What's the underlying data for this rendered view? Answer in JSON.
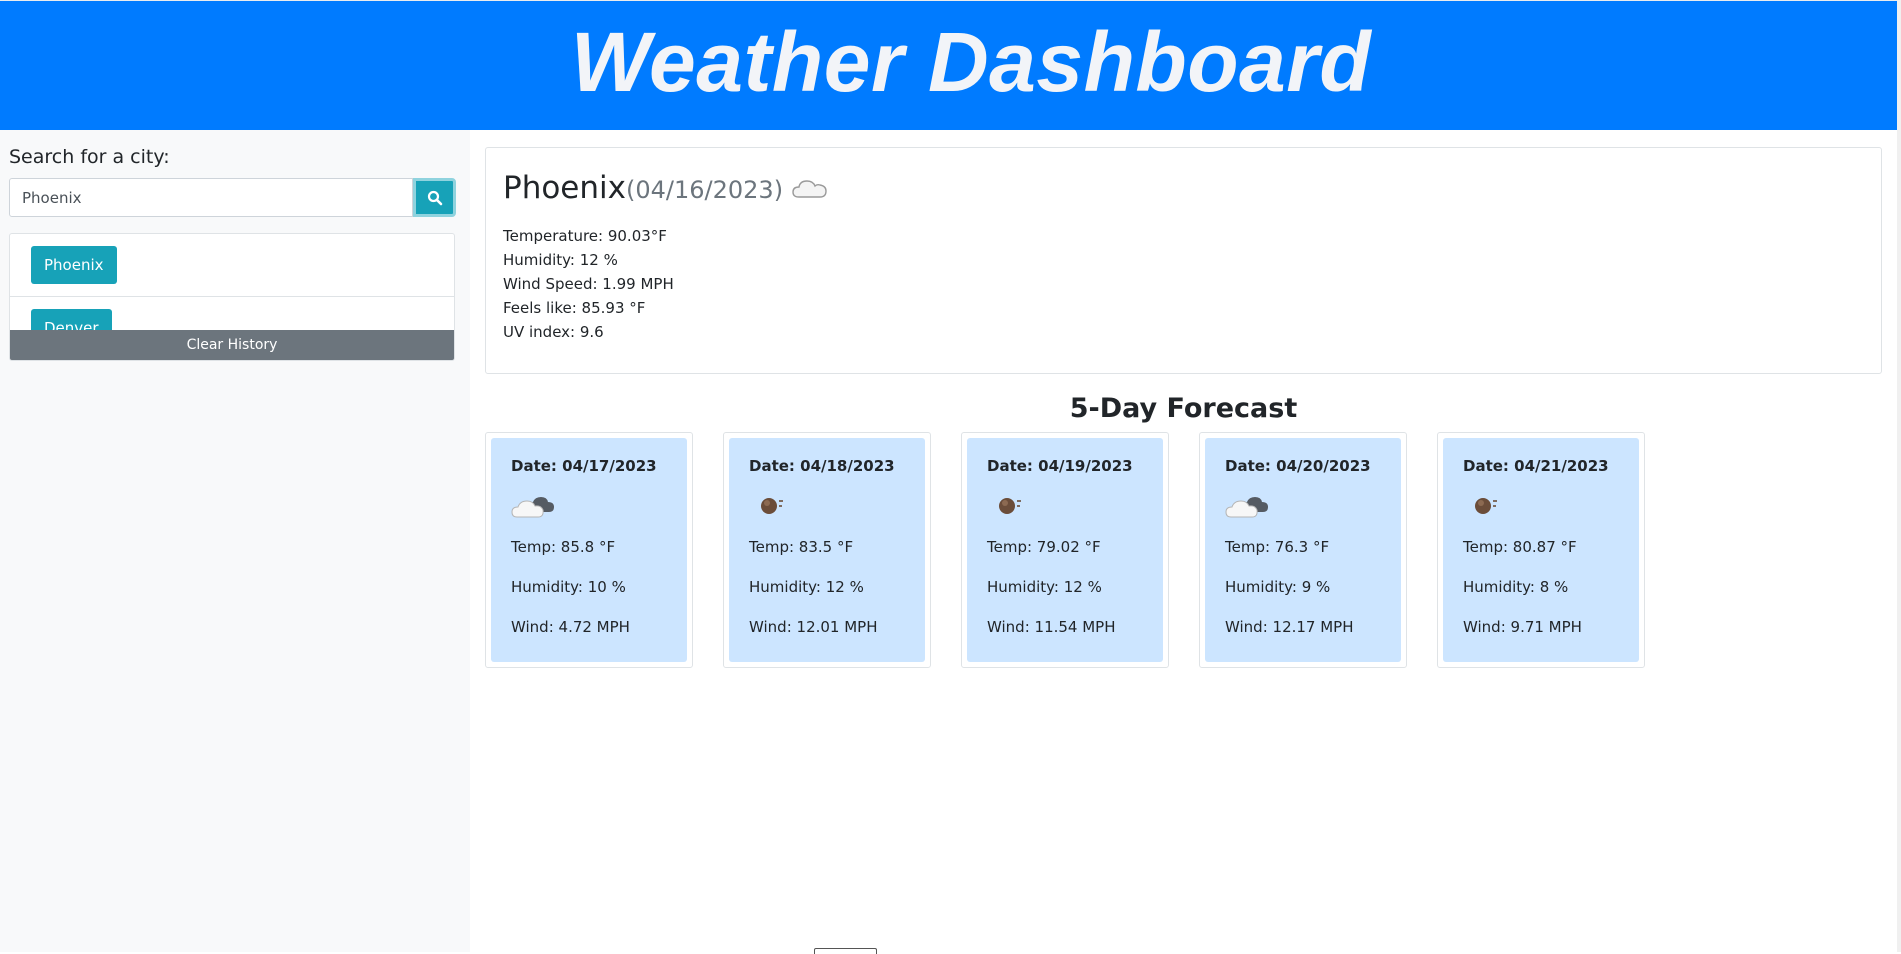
{
  "header": {
    "title": "Weather Dashboard"
  },
  "search": {
    "label": "Search for a city:",
    "input_value": "Phoenix",
    "button_icon": "search-icon"
  },
  "history": {
    "items": [
      {
        "label": "Phoenix"
      },
      {
        "label": "Denver"
      }
    ],
    "clear_label": "Clear History"
  },
  "current": {
    "city": "Phoenix",
    "date": "(04/16/2023)",
    "icon": "cloud-icon",
    "temperature": "Temperature: 90.03°F",
    "humidity": "Humidity: 12 %",
    "wind": "Wind Speed: 1.99 MPH",
    "feels_like": "Feels like: 85.93 °F",
    "uv": "UV index: 9.6"
  },
  "forecast": {
    "title": "5-Day Forecast",
    "days": [
      {
        "date": "Date: 04/17/2023",
        "icon": "night-cloud-icon",
        "temp": "Temp: 85.8 °F",
        "humidity": "Humidity: 10 %",
        "wind": "Wind: 4.72 MPH"
      },
      {
        "date": "Date: 04/18/2023",
        "icon": "dust-icon",
        "temp": "Temp: 83.5 °F",
        "humidity": "Humidity: 12 %",
        "wind": "Wind: 12.01 MPH"
      },
      {
        "date": "Date: 04/19/2023",
        "icon": "dust-icon",
        "temp": "Temp: 79.02 °F",
        "humidity": "Humidity: 12 %",
        "wind": "Wind: 11.54 MPH"
      },
      {
        "date": "Date: 04/20/2023",
        "icon": "night-cloud-icon",
        "temp": "Temp: 76.3 °F",
        "humidity": "Humidity: 9 %",
        "wind": "Wind: 12.17 MPH"
      },
      {
        "date": "Date: 04/21/2023",
        "icon": "dust-icon",
        "temp": "Temp: 80.87 °F",
        "humidity": "Humidity: 8 %",
        "wind": "Wind: 9.71 MPH"
      }
    ]
  },
  "colors": {
    "header_bg": "#007bff",
    "accent": "#17a2b8",
    "secondary": "#6c757d",
    "card_bg": "#cce5ff"
  }
}
